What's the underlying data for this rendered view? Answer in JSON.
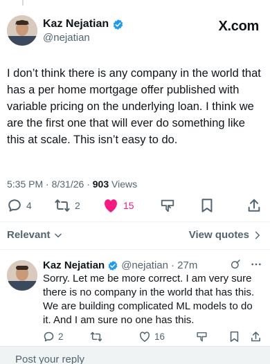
{
  "site_logo": "X.com",
  "colors": {
    "like_pink": "#f91880",
    "verified_blue": "#1d9bf0",
    "muted": "#536471"
  },
  "main_tweet": {
    "author_name": "Kaz Nejatian",
    "handle": "@nejatian",
    "text": "I don’t think there is any company in the world that has a per home mortgage offer published with variable pricing on the underlying loan.  I think we are the first one that will ever do something like this at scale.  This isn’t easy to do.",
    "time": "5:35 PM",
    "date": "8/31/26",
    "separator": "·",
    "views_count": "903",
    "views_label": "Views",
    "replies": "4",
    "reposts": "2",
    "likes": "15"
  },
  "sort": {
    "label": "Relevant",
    "view_quotes": "View quotes"
  },
  "reply": {
    "author_name": "Kaz Nejatian",
    "handle": "@nejatian",
    "age": "· 27m",
    "text": "Sorry. Let me be more correct. I am very sure there is no company in the world that has this. We are building complicated ML models to do it.  And I am sure no one has this.",
    "replies": "2",
    "likes": "16"
  },
  "compose": {
    "placeholder": "Post your reply"
  },
  "icons": [
    "verified-badge-icon",
    "reply-icon",
    "repost-icon",
    "like-icon",
    "bookmark-icon",
    "share-icon",
    "grok-icon",
    "more-icon",
    "chevron-down-icon",
    "chevron-right-icon"
  ]
}
